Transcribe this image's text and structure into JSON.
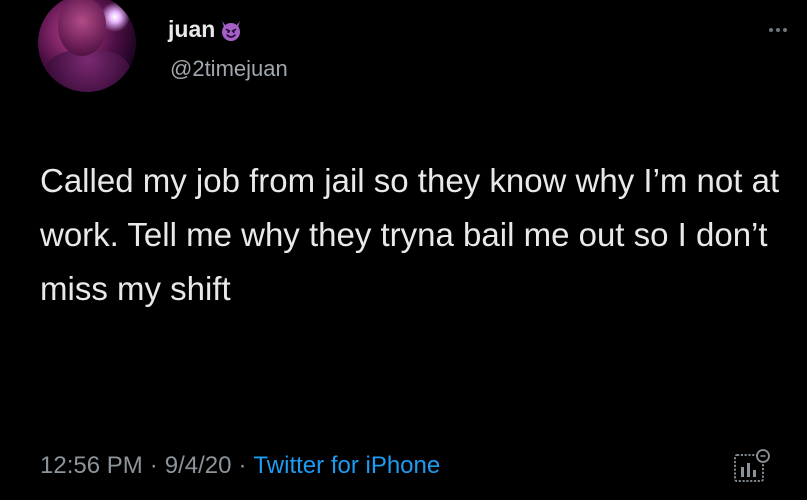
{
  "tweet": {
    "author_name": "juan",
    "author_handle": "@2timejuan",
    "name_emoji_icon": "smiling-devil-icon",
    "text": "Called my job from jail so they know why I’m not at work. Tell me why they tryna bail me out so I don’t miss my shift",
    "time": "12:56 PM",
    "date": "9/4/20",
    "source": "Twitter for iPhone",
    "separator": "·"
  },
  "icons": {
    "more": "more-options-icon",
    "analytics": "view-analytics-icon"
  },
  "colors": {
    "background": "#000000",
    "text": "#e7e9ea",
    "secondary_text": "#8b949b",
    "link": "#1d9bf0",
    "devil_emoji": "#a660c7"
  }
}
